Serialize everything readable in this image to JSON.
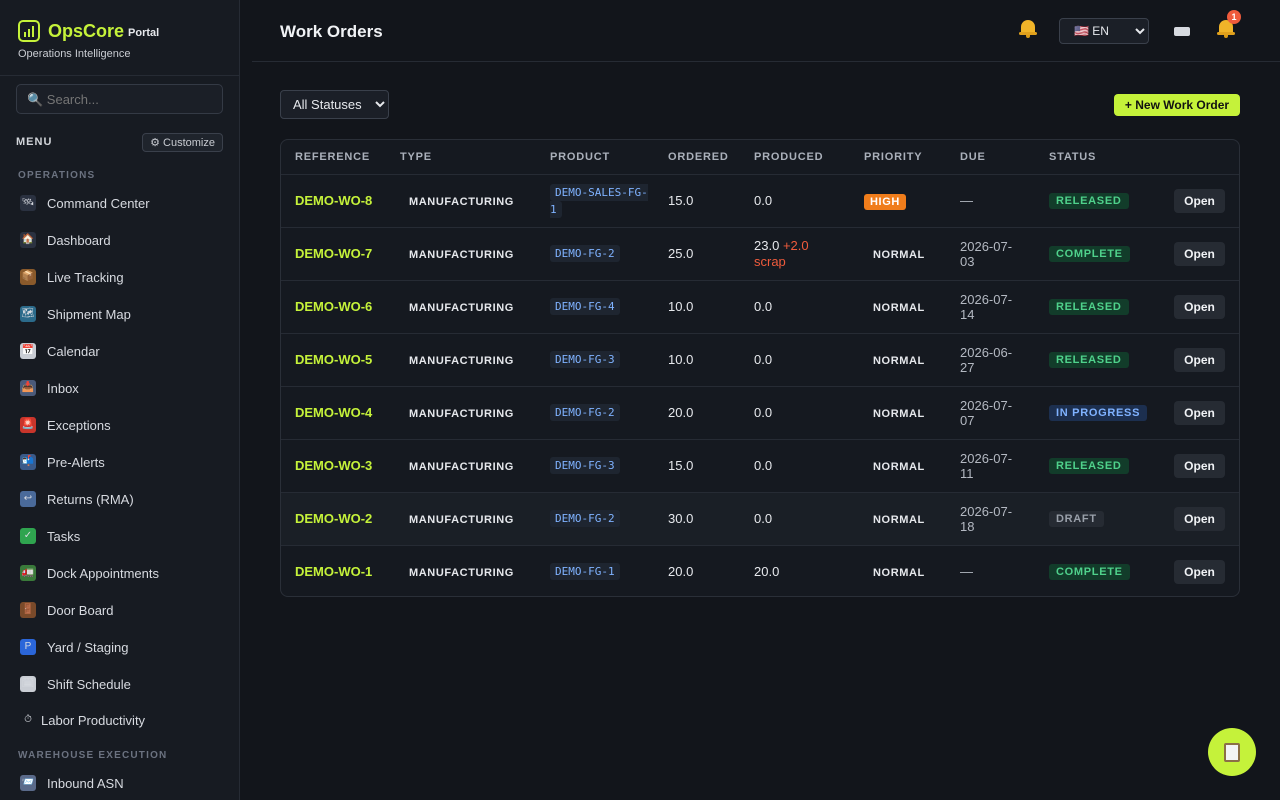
{
  "brand": {
    "name": "OpsCore",
    "suffix": "Portal",
    "subtitle": "Operations Intelligence"
  },
  "sidebar": {
    "search_placeholder": "🔍 Search...",
    "menu_label": "MENU",
    "customize_label": "⚙ Customize",
    "sections": [
      "OPERATIONS",
      "WAREHOUSE EXECUTION"
    ],
    "items": [
      {
        "label": "Command Center",
        "icon": "command-center-icon",
        "glyph": "🛰"
      },
      {
        "label": "Dashboard",
        "icon": "dashboard-icon",
        "glyph": "🏠"
      },
      {
        "label": "Live Tracking",
        "icon": "live-tracking-icon",
        "glyph": "📦"
      },
      {
        "label": "Shipment Map",
        "icon": "shipment-map-icon",
        "glyph": "🗺"
      },
      {
        "label": "Calendar",
        "icon": "calendar-icon",
        "glyph": "📅"
      },
      {
        "label": "Inbox",
        "icon": "inbox-icon",
        "glyph": "📥"
      },
      {
        "label": "Exceptions",
        "icon": "exceptions-icon",
        "glyph": "🚨"
      },
      {
        "label": "Pre-Alerts",
        "icon": "pre-alerts-icon",
        "glyph": "📬"
      },
      {
        "label": "Returns (RMA)",
        "icon": "returns-icon",
        "glyph": "↩"
      },
      {
        "label": "Tasks",
        "icon": "tasks-icon",
        "glyph": "✓"
      },
      {
        "label": "Dock Appointments",
        "icon": "dock-appointments-icon",
        "glyph": "🚛"
      },
      {
        "label": "Door Board",
        "icon": "door-board-icon",
        "glyph": "🚪"
      },
      {
        "label": "Yard / Staging",
        "icon": "yard-staging-icon",
        "glyph": "P"
      },
      {
        "label": "Shift Schedule",
        "icon": "shift-schedule-icon",
        "glyph": "🗓"
      },
      {
        "label": "Labor Productivity",
        "icon": "labor-productivity-icon",
        "glyph": "⏱"
      },
      {
        "label": "Inbound ASN",
        "icon": "inbound-asn-icon",
        "glyph": "📨"
      }
    ]
  },
  "header": {
    "title": "Work Orders",
    "language": "🇺🇸 EN",
    "notification_count": "1"
  },
  "toolbar": {
    "status_filter": "All Statuses",
    "new_button": "+ New Work Order"
  },
  "table": {
    "columns": [
      "REFERENCE",
      "TYPE",
      "PRODUCT",
      "ORDERED",
      "PRODUCED",
      "PRIORITY",
      "DUE",
      "STATUS"
    ],
    "open_label": "Open",
    "rows": [
      {
        "ref": "DEMO-WO-8",
        "type": "MANUFACTURING",
        "product": "DEMO-SALES-FG-1",
        "ordered": "15.0",
        "produced": "0.0",
        "scrap": "",
        "priority": "HIGH",
        "due": "—",
        "status": "RELEASED"
      },
      {
        "ref": "DEMO-WO-7",
        "type": "MANUFACTURING",
        "product": "DEMO-FG-2",
        "ordered": "25.0",
        "produced": "23.0",
        "scrap": "+2.0 scrap",
        "priority": "NORMAL",
        "due": "2026-07-03",
        "status": "COMPLETE"
      },
      {
        "ref": "DEMO-WO-6",
        "type": "MANUFACTURING",
        "product": "DEMO-FG-4",
        "ordered": "10.0",
        "produced": "0.0",
        "scrap": "",
        "priority": "NORMAL",
        "due": "2026-07-14",
        "status": "RELEASED"
      },
      {
        "ref": "DEMO-WO-5",
        "type": "MANUFACTURING",
        "product": "DEMO-FG-3",
        "ordered": "10.0",
        "produced": "0.0",
        "scrap": "",
        "priority": "NORMAL",
        "due": "2026-06-27",
        "status": "RELEASED"
      },
      {
        "ref": "DEMO-WO-4",
        "type": "MANUFACTURING",
        "product": "DEMO-FG-2",
        "ordered": "20.0",
        "produced": "0.0",
        "scrap": "",
        "priority": "NORMAL",
        "due": "2026-07-07",
        "status": "IN PROGRESS"
      },
      {
        "ref": "DEMO-WO-3",
        "type": "MANUFACTURING",
        "product": "DEMO-FG-3",
        "ordered": "15.0",
        "produced": "0.0",
        "scrap": "",
        "priority": "NORMAL",
        "due": "2026-07-11",
        "status": "RELEASED"
      },
      {
        "ref": "DEMO-WO-2",
        "type": "MANUFACTURING",
        "product": "DEMO-FG-2",
        "ordered": "30.0",
        "produced": "0.0",
        "scrap": "",
        "priority": "NORMAL",
        "due": "2026-07-18",
        "status": "DRAFT"
      },
      {
        "ref": "DEMO-WO-1",
        "type": "MANUFACTURING",
        "product": "DEMO-FG-1",
        "ordered": "20.0",
        "produced": "20.0",
        "scrap": "",
        "priority": "NORMAL",
        "due": "—",
        "status": "COMPLETE"
      }
    ]
  },
  "colors": {
    "accent": "#c5f23a",
    "high": "#f07d1b",
    "released": "#4fd18b",
    "in_progress": "#7fb2ff",
    "scrap": "#ef5b3c"
  },
  "fab": {
    "icon": "clipboard-icon"
  }
}
